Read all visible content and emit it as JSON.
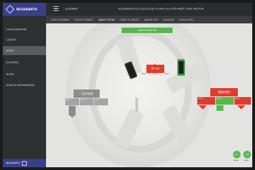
{
  "brand": {
    "name": "BEISSBARTH",
    "icon": "logo-diamond-icon"
  },
  "header": {
    "title": "ALIGNMENT",
    "vehicle": "VOLKSWAGEN  2015-2016 CADDY  4x  (MK4+4x)  FOUR WHEEL DRIVE  4MOTION"
  },
  "sidebar": {
    "items": [
      {
        "label": "CONFIGURATION"
      },
      {
        "label": "CASTER"
      },
      {
        "label": "SETUP",
        "active": true
      },
      {
        "label": "ELEVATED"
      },
      {
        "label": "ALIGN"
      },
      {
        "label": "VEHICLE INFORMATION"
      }
    ],
    "footer": "BEISSBARTH"
  },
  "tabs": [
    {
      "label": "LEVEL STEERING"
    },
    {
      "label": "STEER TO ADJUST"
    },
    {
      "label": "ADJUST FRONT",
      "active": true
    },
    {
      "label": "STEER TO ADJUST"
    },
    {
      "label": "ADJUST LEFT"
    },
    {
      "label": "EQUALIZE"
    },
    {
      "label": "CHECK LEVEL"
    }
  ],
  "banner": "Adjust Right Toe",
  "toe": {
    "value": "2mm",
    "scale": [
      "0mm",
      "0mm",
      "0mm"
    ],
    "color": "#e23b2c"
  },
  "camber": {
    "value": "-1mm",
    "cells": [
      "0mm",
      "0mm",
      "0mm"
    ],
    "color": "#8d8d8d"
  },
  "caster": {
    "value": "4mm",
    "cells": [
      "1mm",
      "0mm",
      "0mm"
    ],
    "color": "#e23b2c",
    "ok_color": "#55b84a"
  },
  "nav": {
    "back": "BACK",
    "next": "NEXT"
  }
}
